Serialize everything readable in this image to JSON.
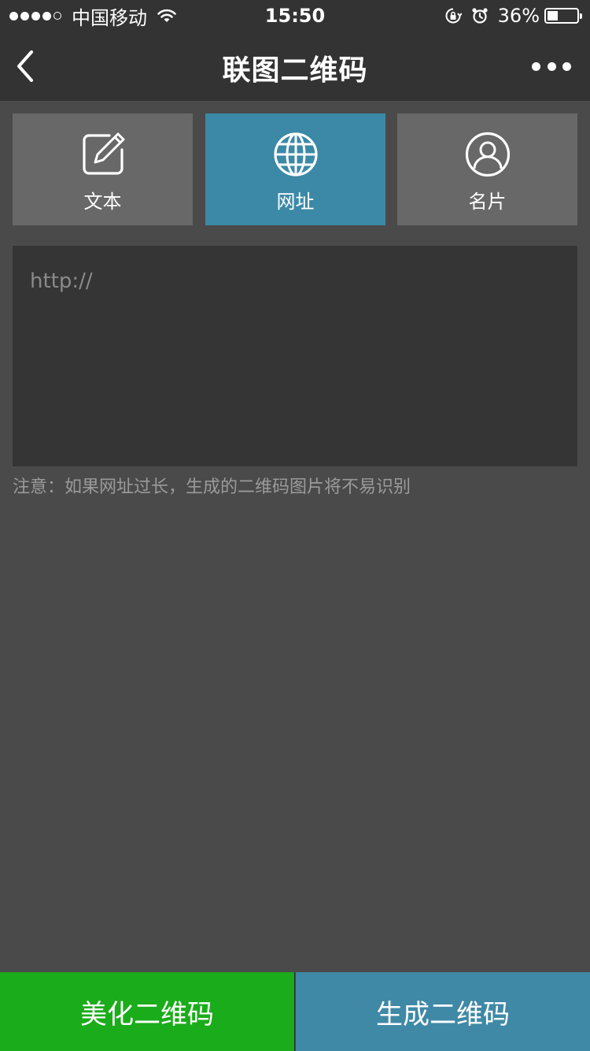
{
  "status_bar": {
    "carrier": "中国移动",
    "time": "15:50",
    "battery_percent": "36%",
    "battery_level": 0.36,
    "signal_filled": 4,
    "signal_total": 5
  },
  "nav": {
    "title": "联图二维码",
    "back_icon": "chevron-left-icon",
    "more_icon": "more-dots-icon"
  },
  "tabs": [
    {
      "label": "文本",
      "icon": "edit-icon",
      "active": false
    },
    {
      "label": "网址",
      "icon": "globe-icon",
      "active": true
    },
    {
      "label": "名片",
      "icon": "user-icon",
      "active": false
    }
  ],
  "url_input": {
    "value": "",
    "placeholder": "http://"
  },
  "note": "注意：如果网址过长，生成的二维码图片将不易识别",
  "buttons": {
    "beautify": "美化二维码",
    "generate": "生成二维码"
  },
  "colors": {
    "active_tab": "#3b89a6",
    "beautify_button": "#1bac1b",
    "generate_button": "#3f89a6"
  }
}
